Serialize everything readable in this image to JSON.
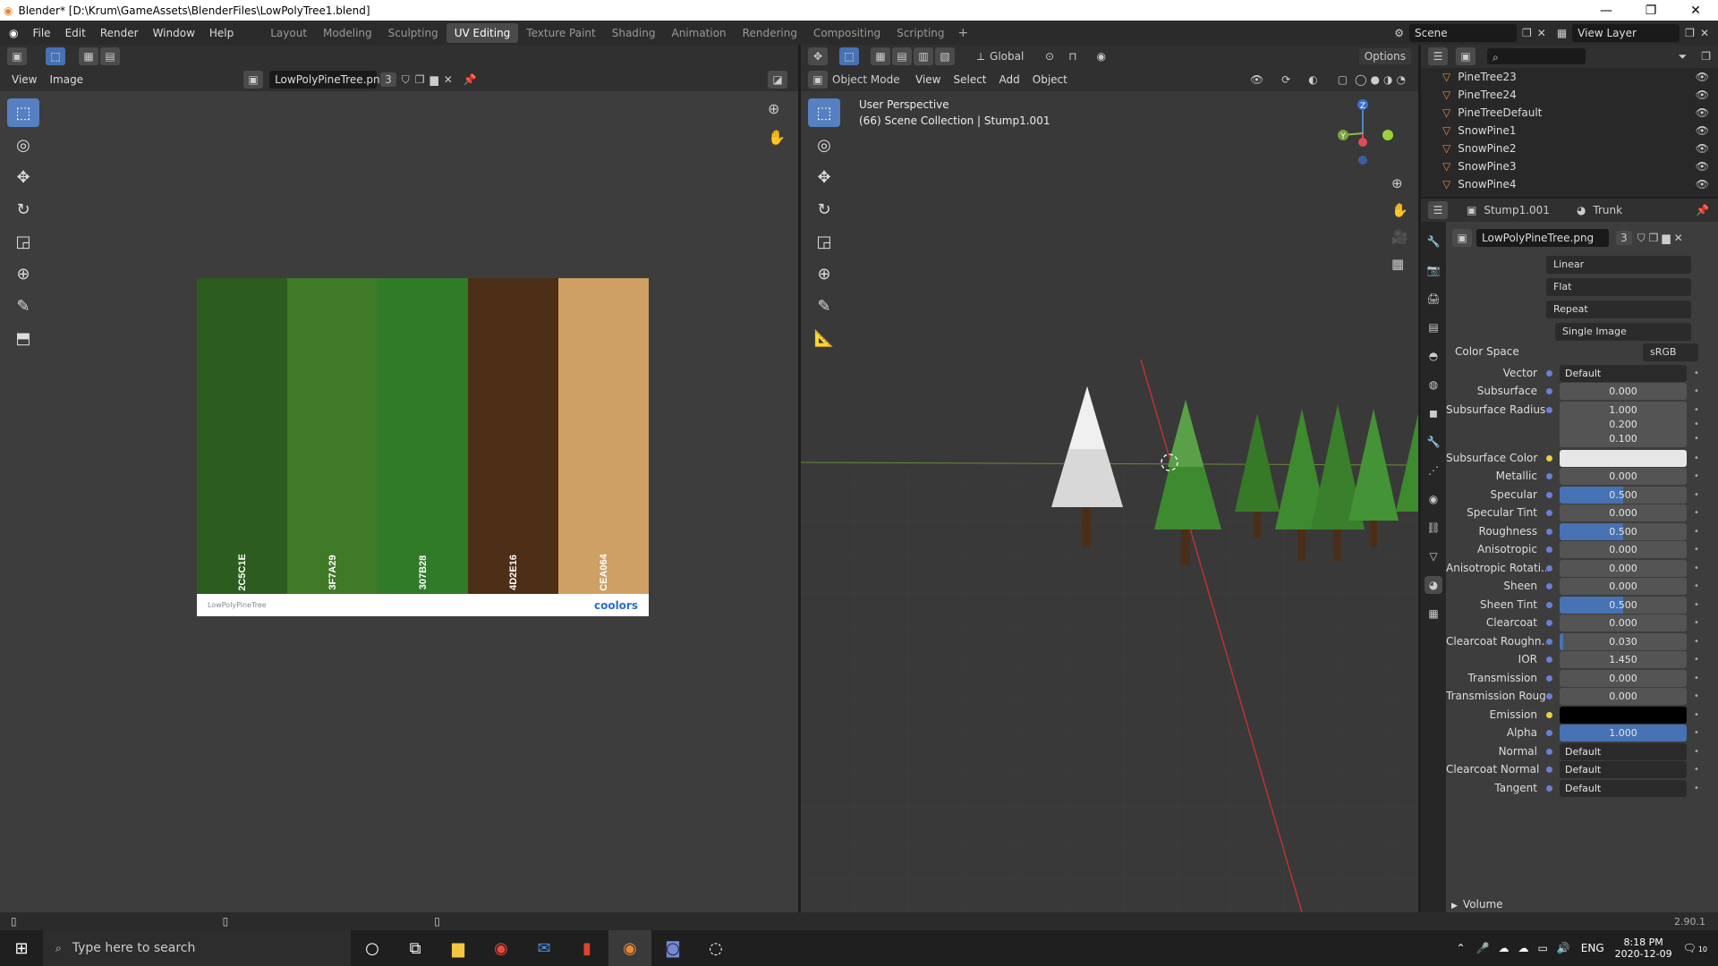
{
  "window": {
    "title": "Blender* [D:\\Krum\\GameAssets\\BlenderFiles\\LowPolyTree1.blend]",
    "minimize": "—",
    "maximize": "❐",
    "close": "✕"
  },
  "menu": [
    "File",
    "Edit",
    "Render",
    "Window",
    "Help"
  ],
  "workspaces": [
    "Layout",
    "Modeling",
    "Sculpting",
    "UV Editing",
    "Texture Paint",
    "Shading",
    "Animation",
    "Rendering",
    "Compositing",
    "Scripting"
  ],
  "active_workspace": "UV Editing",
  "scene": "Scene",
  "view_layer": "View Layer",
  "uv_editor": {
    "menus": [
      "View",
      "Image"
    ],
    "image_name": "LowPolyPineTree.png",
    "users": "3",
    "palette": {
      "colors": [
        {
          "hex": "#2C5C1E",
          "label": "2C5C1E"
        },
        {
          "hex": "#3F7A29",
          "label": "3F7A29"
        },
        {
          "hex": "#307B28",
          "label": "307B28"
        },
        {
          "hex": "#4D2E16",
          "label": "4D2E16"
        },
        {
          "hex": "#CEA064",
          "label": "CEA064"
        }
      ],
      "name": "LowPolyPineTree",
      "brand": "coolors"
    }
  },
  "viewport": {
    "mode": "Object Mode",
    "menus": [
      "View",
      "Select",
      "Add",
      "Object"
    ],
    "transform": "Global",
    "options": "Options",
    "perspective": "User Perspective",
    "collection_info": "(66) Scene Collection | Stump1.001",
    "gizmo": {
      "z": "Z",
      "y": "Y",
      "x": "X"
    }
  },
  "outliner": {
    "items": [
      "PineTree23",
      "PineTree24",
      "PineTreeDefault",
      "SnowPine1",
      "SnowPine2",
      "SnowPine3",
      "SnowPine4"
    ]
  },
  "properties": {
    "object": "Stump1.001",
    "material": "Trunk",
    "image": "LowPolyPineTree.png",
    "image_users": "3",
    "dropdowns": [
      "Linear",
      "Flat",
      "Repeat",
      "Single Image"
    ],
    "color_space_label": "Color Space",
    "color_space": "sRGB",
    "rows": [
      {
        "label": "Vector",
        "value": "Default",
        "kind": "link"
      },
      {
        "label": "Subsurface",
        "value": "0.000",
        "fill": 0
      },
      {
        "label": "Subsurface Radius",
        "value": "1.000",
        "fill": 0
      },
      {
        "label": "",
        "value": "0.200",
        "fill": 0
      },
      {
        "label": "",
        "value": "0.100",
        "fill": 0
      },
      {
        "label": "Subsurface Color",
        "value": "",
        "kind": "color",
        "color": "#e6e6e6"
      },
      {
        "label": "Metallic",
        "value": "0.000",
        "fill": 0
      },
      {
        "label": "Specular",
        "value": "0.500",
        "fill": 0.5
      },
      {
        "label": "Specular Tint",
        "value": "0.000",
        "fill": 0
      },
      {
        "label": "Roughness",
        "value": "0.500",
        "fill": 0.5
      },
      {
        "label": "Anisotropic",
        "value": "0.000",
        "fill": 0
      },
      {
        "label": "Anisotropic Rotati...",
        "value": "0.000",
        "fill": 0
      },
      {
        "label": "Sheen",
        "value": "0.000",
        "fill": 0
      },
      {
        "label": "Sheen Tint",
        "value": "0.500",
        "fill": 0.5
      },
      {
        "label": "Clearcoat",
        "value": "0.000",
        "fill": 0
      },
      {
        "label": "Clearcoat Roughn...",
        "value": "0.030",
        "fill": 0.03
      },
      {
        "label": "IOR",
        "value": "1.450",
        "fill": 0
      },
      {
        "label": "Transmission",
        "value": "0.000",
        "fill": 0
      },
      {
        "label": "Transmission Roug...",
        "value": "0.000",
        "fill": 0
      },
      {
        "label": "Emission",
        "value": "",
        "kind": "color",
        "color": "#000000"
      },
      {
        "label": "Alpha",
        "value": "1.000",
        "fill": 1
      },
      {
        "label": "Normal",
        "value": "Default",
        "kind": "link"
      },
      {
        "label": "Clearcoat Normal",
        "value": "Default",
        "kind": "link"
      },
      {
        "label": "Tangent",
        "value": "Default",
        "kind": "link"
      }
    ],
    "volume": "Volume"
  },
  "status": {
    "version": "2.90.1"
  },
  "taskbar": {
    "search_placeholder": "Type here to search",
    "time": "8:18 PM",
    "date": "2020-12-09",
    "lang": "ENG",
    "notif": "10"
  }
}
